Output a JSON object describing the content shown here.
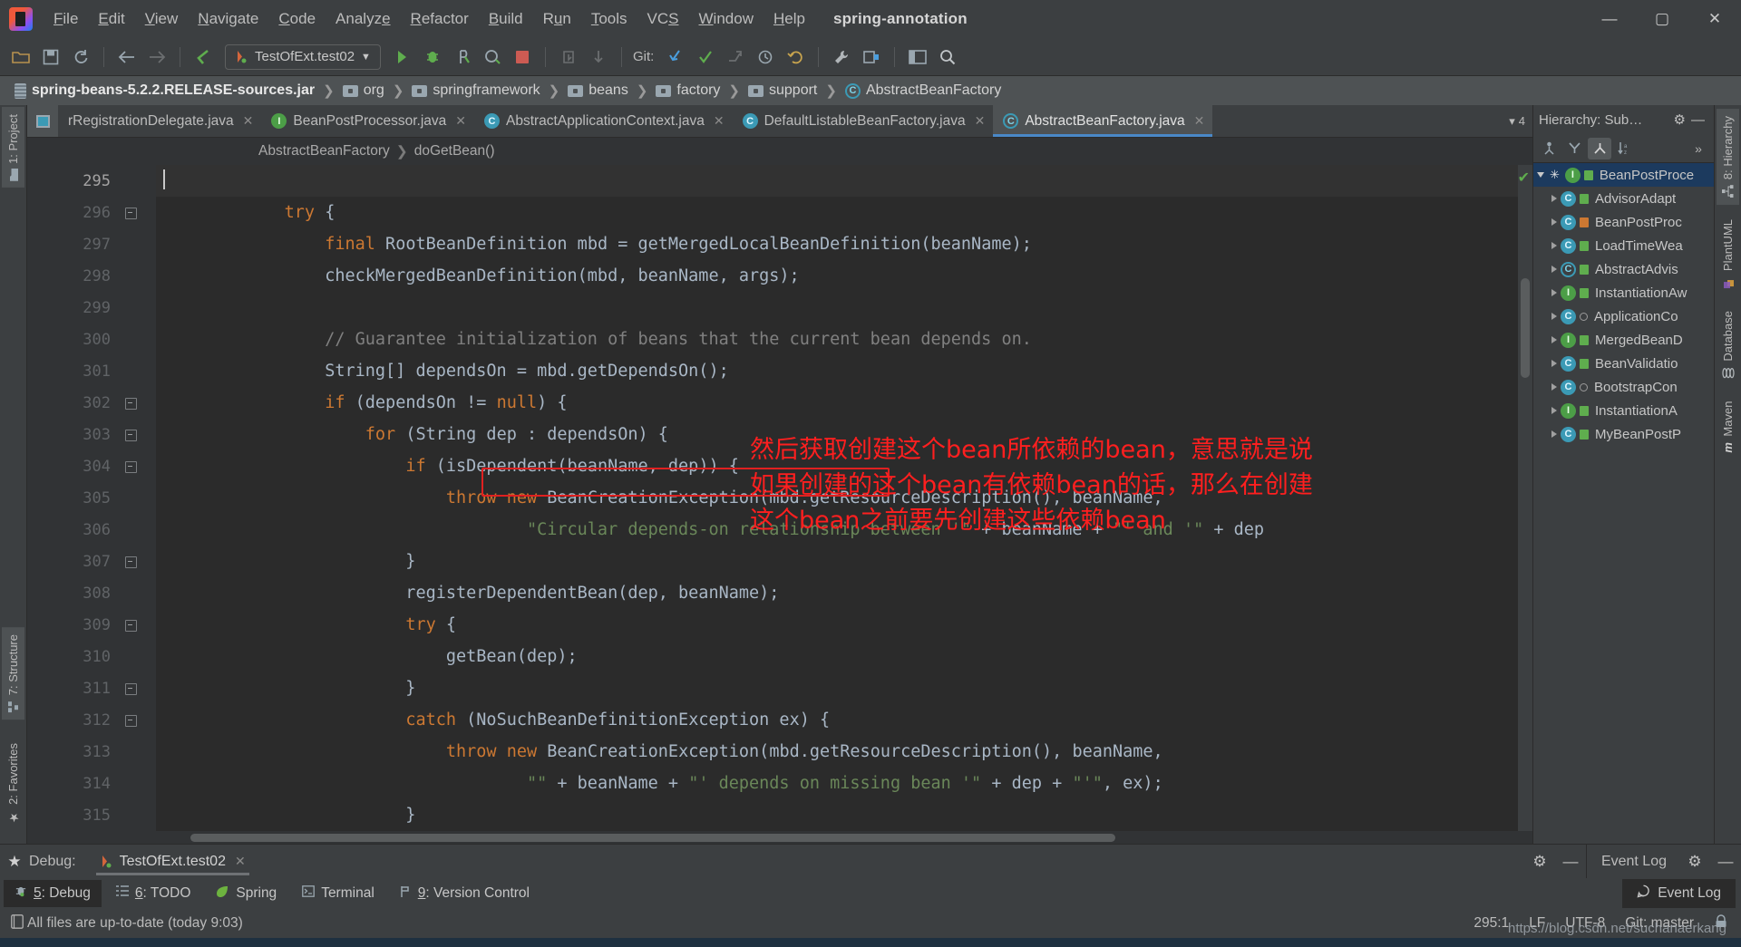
{
  "window": {
    "project_name": "spring-annotation",
    "minimize": "—",
    "maximize": "▢",
    "close": "✕"
  },
  "menubar": {
    "items": [
      "File",
      "Edit",
      "View",
      "Navigate",
      "Code",
      "Analyze",
      "Refactor",
      "Build",
      "Run",
      "Tools",
      "VCS",
      "Window",
      "Help"
    ]
  },
  "toolbar": {
    "run_config": "TestOfExt.test02",
    "git_label": "Git:",
    "open_icon": "open-folder-icon",
    "save_icon": "save-icon",
    "sync_icon": "sync-icon",
    "back_icon": "back-arrow-icon",
    "forward_icon": "forward-arrow-icon",
    "compile_icon": "compile-icon",
    "run_icon": "run-icon",
    "debug_icon": "debug-icon",
    "run_coverage_icon": "coverage-icon",
    "profile_icon": "profile-icon",
    "stop_icon": "stop-icon",
    "update_icon": "vcs-update-icon",
    "commit_icon": "vcs-commit-icon",
    "git_pull_icon": "git-pull-icon",
    "git_check_icon": "git-check-icon",
    "git_push_icon": "git-push-icon",
    "history_icon": "history-icon",
    "revert_icon": "revert-icon",
    "settings_icon": "settings-wrench-icon",
    "plugins_icon": "plugins-icon",
    "layout_icon": "layout-icon",
    "search_icon": "search-icon"
  },
  "navbar": {
    "crumbs": [
      {
        "label": "spring-beans-5.2.2.RELEASE-sources.jar",
        "icon": "jar-icon"
      },
      {
        "label": "org",
        "icon": "folder-icon"
      },
      {
        "label": "springframework",
        "icon": "folder-icon"
      },
      {
        "label": "beans",
        "icon": "folder-icon"
      },
      {
        "label": "factory",
        "icon": "folder-icon"
      },
      {
        "label": "support",
        "icon": "folder-icon"
      },
      {
        "label": "AbstractBeanFactory",
        "icon": "abstract-class-icon"
      }
    ]
  },
  "left_rail": {
    "tabs": [
      {
        "label": "1: Project",
        "icon": "project-folder-icon",
        "active": true
      },
      {
        "label": "7: Structure",
        "icon": "structure-icon",
        "active": false
      },
      {
        "label": "2: Favorites",
        "icon": "favorites-icon",
        "active": false
      }
    ]
  },
  "editor_tabs": {
    "tabs": [
      {
        "label": "rRegistrationDelegate.java",
        "icon": "java-file-icon",
        "active": false
      },
      {
        "label": "BeanPostProcessor.java",
        "icon": "interface-icon",
        "active": false
      },
      {
        "label": "AbstractApplicationContext.java",
        "icon": "class-icon",
        "active": false
      },
      {
        "label": "DefaultListableBeanFactory.java",
        "icon": "class-icon",
        "active": false
      },
      {
        "label": "AbstractBeanFactory.java",
        "icon": "abstract-class-icon",
        "active": true
      }
    ],
    "overflow_count": "4",
    "close_glyph": "✕"
  },
  "editor_breadcrumb": {
    "parts": [
      "AbstractBeanFactory",
      "doGetBean()"
    ]
  },
  "code": {
    "first_line_number": 295,
    "lines": [
      {
        "n": 295,
        "current": true,
        "caret": true,
        "tokens": [
          {
            "t": "",
            "c": ""
          }
        ]
      },
      {
        "n": 296,
        "fold": true,
        "tokens": [
          {
            "t": "            ",
            "c": ""
          },
          {
            "t": "try",
            "c": "kw"
          },
          {
            "t": " {",
            "c": ""
          }
        ]
      },
      {
        "n": 297,
        "tokens": [
          {
            "t": "                ",
            "c": ""
          },
          {
            "t": "final",
            "c": "kw"
          },
          {
            "t": " RootBeanDefinition mbd = getMergedLocalBeanDefinition(beanName);",
            "c": ""
          }
        ]
      },
      {
        "n": 298,
        "tokens": [
          {
            "t": "                checkMergedBeanDefinition(mbd, beanName, args);",
            "c": ""
          }
        ]
      },
      {
        "n": 299,
        "tokens": [
          {
            "t": "",
            "c": ""
          }
        ]
      },
      {
        "n": 300,
        "tokens": [
          {
            "t": "                ",
            "c": ""
          },
          {
            "t": "// Guarantee initialization of beans that the current bean depends on.",
            "c": "cmt"
          }
        ]
      },
      {
        "n": 301,
        "boxed": true,
        "tokens": [
          {
            "t": "                String[] dependsOn = mbd.getDependsOn();",
            "c": ""
          }
        ]
      },
      {
        "n": 302,
        "fold": true,
        "tokens": [
          {
            "t": "                ",
            "c": ""
          },
          {
            "t": "if",
            "c": "kw"
          },
          {
            "t": " (dependsOn != ",
            "c": ""
          },
          {
            "t": "null",
            "c": "kw"
          },
          {
            "t": ") {",
            "c": ""
          }
        ]
      },
      {
        "n": 303,
        "fold": true,
        "tokens": [
          {
            "t": "                    ",
            "c": ""
          },
          {
            "t": "for",
            "c": "kw"
          },
          {
            "t": " (String dep : dependsOn) {",
            "c": ""
          }
        ]
      },
      {
        "n": 304,
        "fold": true,
        "tokens": [
          {
            "t": "                        ",
            "c": ""
          },
          {
            "t": "if",
            "c": "kw"
          },
          {
            "t": " (isDependent(beanName, dep)) {",
            "c": ""
          }
        ]
      },
      {
        "n": 305,
        "tokens": [
          {
            "t": "                            ",
            "c": ""
          },
          {
            "t": "throw",
            "c": "kw"
          },
          {
            "t": " ",
            "c": ""
          },
          {
            "t": "new",
            "c": "kw"
          },
          {
            "t": " BeanCreationException(mbd.getResourceDescription(), beanName,",
            "c": ""
          }
        ]
      },
      {
        "n": 306,
        "tokens": [
          {
            "t": "                                    ",
            "c": ""
          },
          {
            "t": "\"Circular depends-on relationship between '\"",
            "c": "str"
          },
          {
            "t": " + beanName + ",
            "c": ""
          },
          {
            "t": "\"' and '\"",
            "c": "str"
          },
          {
            "t": " + dep",
            "c": ""
          }
        ]
      },
      {
        "n": 307,
        "fold": true,
        "tokens": [
          {
            "t": "                        }",
            "c": ""
          }
        ]
      },
      {
        "n": 308,
        "tokens": [
          {
            "t": "                        registerDependentBean(dep, beanName);",
            "c": ""
          }
        ]
      },
      {
        "n": 309,
        "fold": true,
        "tokens": [
          {
            "t": "                        ",
            "c": ""
          },
          {
            "t": "try",
            "c": "kw"
          },
          {
            "t": " {",
            "c": ""
          }
        ]
      },
      {
        "n": 310,
        "tokens": [
          {
            "t": "                            getBean(dep);",
            "c": ""
          }
        ]
      },
      {
        "n": 311,
        "fold": true,
        "tokens": [
          {
            "t": "                        }",
            "c": ""
          }
        ]
      },
      {
        "n": 312,
        "fold": true,
        "tokens": [
          {
            "t": "                        ",
            "c": ""
          },
          {
            "t": "catch",
            "c": "kw"
          },
          {
            "t": " (NoSuchBeanDefinitionException ex) {",
            "c": ""
          }
        ]
      },
      {
        "n": 313,
        "tokens": [
          {
            "t": "                            ",
            "c": ""
          },
          {
            "t": "throw",
            "c": "kw"
          },
          {
            "t": " ",
            "c": ""
          },
          {
            "t": "new",
            "c": "kw"
          },
          {
            "t": " BeanCreationException(mbd.getResourceDescription(), beanName,",
            "c": ""
          }
        ]
      },
      {
        "n": 314,
        "tokens": [
          {
            "t": "                                    ",
            "c": ""
          },
          {
            "t": "\"\"",
            "c": "str"
          },
          {
            "t": " + beanName + ",
            "c": ""
          },
          {
            "t": "\"' depends on missing bean '\"",
            "c": "str"
          },
          {
            "t": " + dep + ",
            "c": ""
          },
          {
            "t": "\"'\"",
            "c": "str"
          },
          {
            "t": ", ex);",
            "c": ""
          }
        ]
      },
      {
        "n": 315,
        "tokens": [
          {
            "t": "                        }",
            "c": ""
          }
        ]
      }
    ]
  },
  "annotation": {
    "color": "#ff1f1f",
    "lines": [
      "然后获取创建这个bean所依赖的bean，意思就是说",
      "如果创建的这个bean有依赖bean的话，那么在创建",
      "这个bean之前要先创建这些依赖bean"
    ]
  },
  "hierarchy": {
    "title": "Hierarchy:  Sub…",
    "gear_icon": "gear-icon",
    "minimize_icon": "minimize-icon",
    "tools": [
      {
        "name": "type-hierarchy-icon",
        "glyph": "⚇",
        "active": false
      },
      {
        "name": "supertype-hierarchy-icon",
        "glyph": "Y",
        "active": false
      },
      {
        "name": "subtype-hierarchy-icon",
        "glyph": "⟂",
        "active": true
      },
      {
        "name": "sort-alphabetically-icon",
        "glyph": "↓ᴬ",
        "active": false
      },
      {
        "name": "more-options-icon",
        "glyph": "»",
        "active": false
      }
    ],
    "rows": [
      {
        "label": "BeanPostProce",
        "kind": "interface",
        "lock": "green",
        "selected": true,
        "expanded": true,
        "star": true,
        "indent": 0
      },
      {
        "label": "AdvisorAdapt",
        "kind": "class",
        "lock": "green",
        "indent": 1
      },
      {
        "label": "BeanPostProc",
        "kind": "class",
        "lock": "orange",
        "indent": 1
      },
      {
        "label": "LoadTimeWea",
        "kind": "class",
        "lock": "green",
        "indent": 1
      },
      {
        "label": "AbstractAdvis",
        "kind": "abstract",
        "lock": "green",
        "indent": 1
      },
      {
        "label": "InstantiationAw",
        "kind": "interface",
        "lock": "green",
        "indent": 1
      },
      {
        "label": "ApplicationCo",
        "kind": "class",
        "lock": "hollow",
        "indent": 1
      },
      {
        "label": "MergedBeanD",
        "kind": "interface",
        "lock": "green",
        "indent": 1
      },
      {
        "label": "BeanValidatio",
        "kind": "class",
        "lock": "green",
        "indent": 1
      },
      {
        "label": "BootstrapCon",
        "kind": "class",
        "lock": "hollow",
        "indent": 1
      },
      {
        "label": "InstantiationA",
        "kind": "interface",
        "lock": "green",
        "indent": 1
      },
      {
        "label": "MyBeanPostP",
        "kind": "class",
        "lock": "green",
        "indent": 1
      }
    ]
  },
  "right_rail": {
    "tabs": [
      {
        "label": "8: Hierarchy",
        "icon": "hierarchy-icon",
        "active": true
      },
      {
        "label": "PlantUML",
        "icon": "plantuml-icon",
        "active": false
      },
      {
        "label": "Database",
        "icon": "database-icon",
        "active": false
      },
      {
        "label": "Maven",
        "icon": "maven-icon",
        "active": false
      }
    ]
  },
  "bottom_panel": {
    "debug_label": "Debug:",
    "debug_session": "TestOfExt.test02",
    "close_glyph": "✕",
    "star_icon": "favorites-star-icon",
    "event_log_title": "Event Log",
    "gear_icon": "gear-icon",
    "minimize_icon": "minimize-icon"
  },
  "status_tabs": {
    "tabs": [
      {
        "label": "5: Debug",
        "icon": "debug-icon",
        "active": true,
        "mnemonic": "5"
      },
      {
        "label": "6: TODO",
        "icon": "todo-icon",
        "active": false,
        "mnemonic": "6"
      },
      {
        "label": "Spring",
        "icon": "spring-leaf-icon",
        "active": false,
        "mnemonic": ""
      },
      {
        "label": "Terminal",
        "icon": "terminal-icon",
        "active": false,
        "mnemonic": ""
      },
      {
        "label": "9: Version Control",
        "icon": "version-control-icon",
        "active": false,
        "mnemonic": "9"
      }
    ],
    "event_log_pill": "Event Log",
    "event_log_icon": "event-log-icon"
  },
  "statusbar": {
    "message": "All files are up-to-date (today 9:03)",
    "message_icon": "document-icon",
    "caret_position": "295:1",
    "line_separator": "LF",
    "encoding": "UTF-8",
    "branch": "Git: master",
    "lock_icon": "read-only-icon",
    "watermark": "https://blog.csdn.net/suchanaerkang"
  }
}
